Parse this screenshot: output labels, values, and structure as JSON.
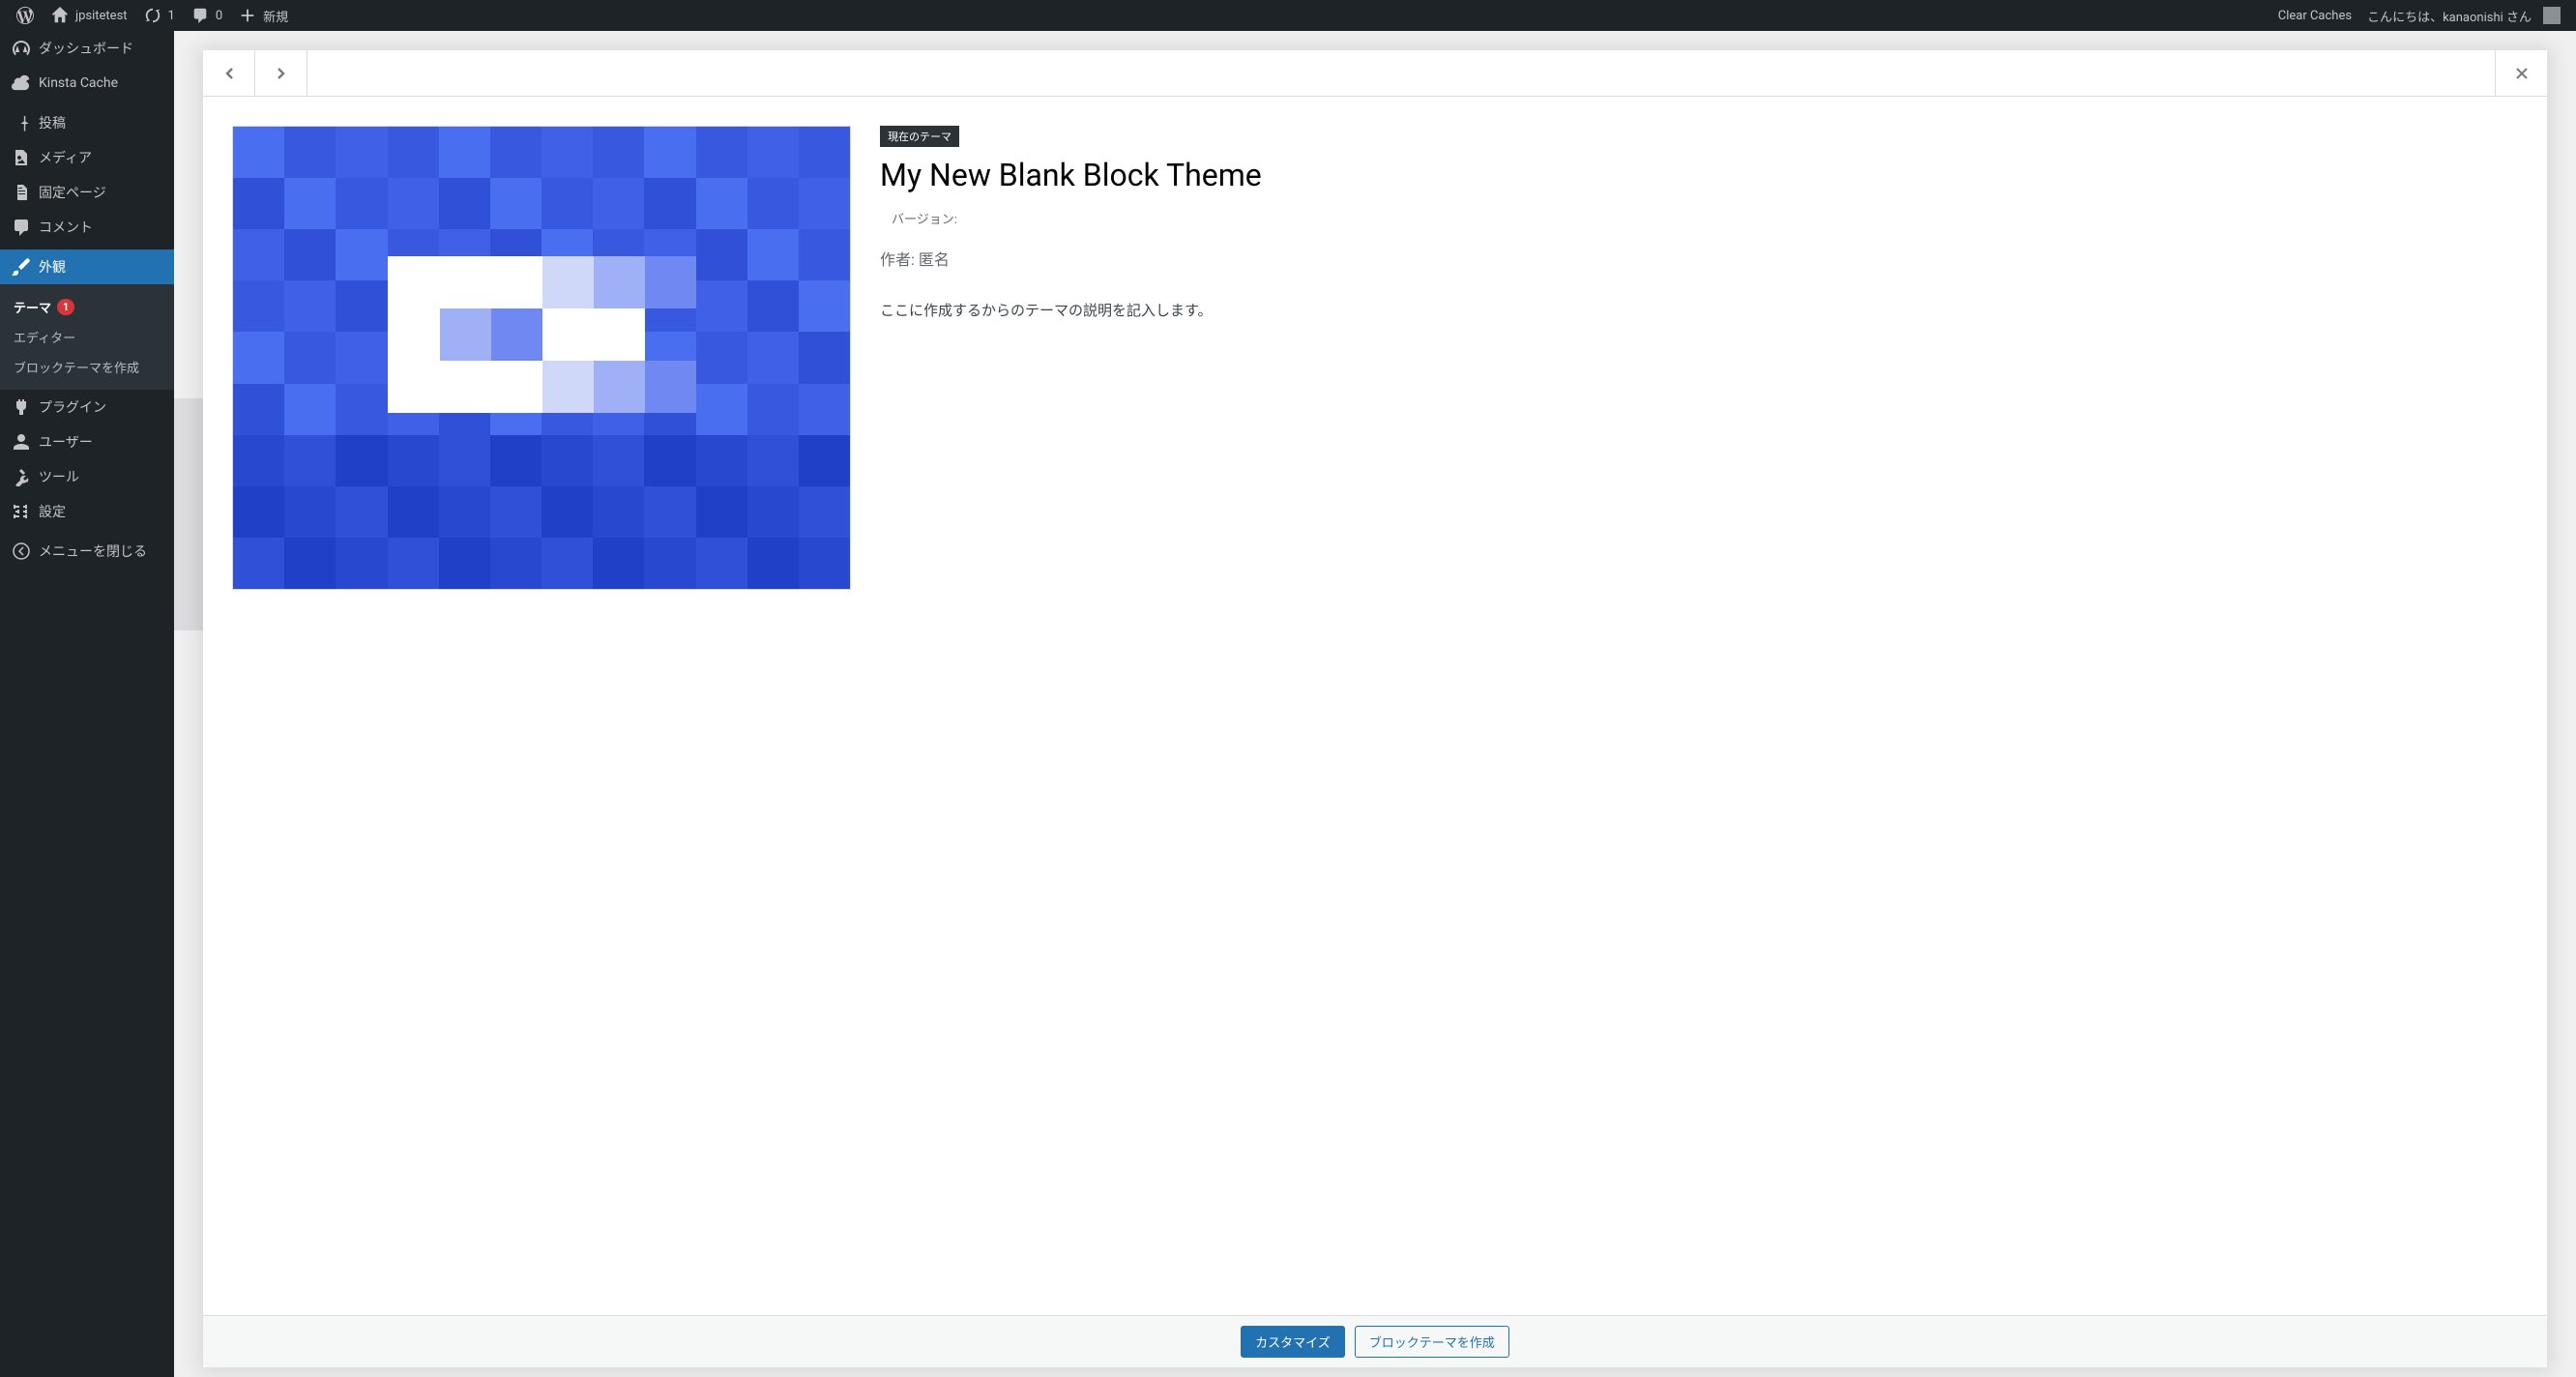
{
  "adminbar": {
    "site_name": "jpsitetest",
    "updates_count": "1",
    "comments_count": "0",
    "new_label": "新規",
    "clear_caches": "Clear Caches",
    "greeting": "こんにちは、kanaonishi さん"
  },
  "sidebar": {
    "dashboard": "ダッシュボード",
    "kinsta_cache": "Kinsta Cache",
    "posts": "投稿",
    "media": "メディア",
    "pages": "固定ページ",
    "comments": "コメント",
    "appearance": "外観",
    "plugins": "プラグイン",
    "users": "ユーザー",
    "tools": "ツール",
    "settings": "設定",
    "collapse": "メニューを閉じる",
    "submenu": {
      "themes": "テーマ",
      "themes_count": "1",
      "editor": "エディター",
      "create_block_theme": "ブロックテーマを作成"
    }
  },
  "modal": {
    "current_label": "現在のテーマ",
    "theme_name": "My New Blank Block Theme",
    "version_label": "バージョン:",
    "author_label": "作者: 匿名",
    "description": "ここに作成するからのテーマの説明を記入します。",
    "customize_btn": "カスタマイズ",
    "create_block_btn": "ブロックテーマを作成"
  }
}
